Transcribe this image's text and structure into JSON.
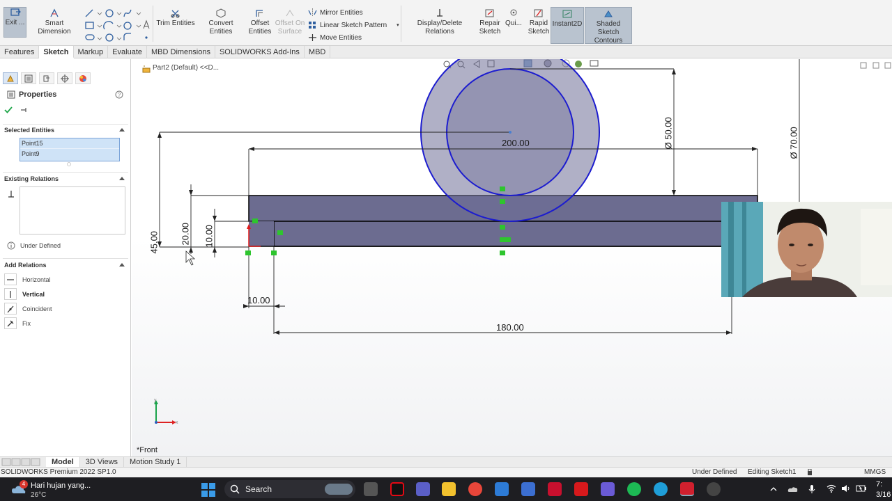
{
  "ribbon": {
    "exit_label": "Exit ...",
    "smart_dimension": "Smart Dimension",
    "trim_entities": "Trim Entities",
    "convert_entities": "Convert Entities",
    "offset_entities_line1": "Offset",
    "offset_entities_line2": "Entities",
    "offset_on_surface_line1": "Offset On",
    "offset_on_surface_line2": "Surface",
    "mirror_entities": "Mirror Entities",
    "linear_sketch_pattern": "Linear Sketch Pattern",
    "move_entities": "Move Entities",
    "display_delete_relations": "Display/Delete Relations",
    "repair_sketch_line1": "Repair",
    "repair_sketch_line2": "Sketch",
    "quick_snaps": "Qui...",
    "rapid_sketch_line1": "Rapid",
    "rapid_sketch_line2": "Sketch",
    "instant2d": "Instant2D",
    "shaded_sketch_line1": "Shaded Sketch",
    "shaded_sketch_line2": "Contours"
  },
  "command_tabs": [
    {
      "label": "Features"
    },
    {
      "label": "Sketch",
      "active": true
    },
    {
      "label": "Markup"
    },
    {
      "label": "Evaluate"
    },
    {
      "label": "MBD Dimensions"
    },
    {
      "label": "SOLIDWORKS Add-Ins"
    },
    {
      "label": "MBD"
    }
  ],
  "property_manager": {
    "title": "Properties",
    "selected_entities_header": "Selected Entities",
    "selected_entities": [
      "Point15",
      "Point9"
    ],
    "existing_relations_header": "Existing Relations",
    "status": "Under Defined",
    "add_relations_header": "Add Relations",
    "relations": [
      {
        "label": "Horizontal",
        "bold": false
      },
      {
        "label": "Vertical",
        "bold": true
      },
      {
        "label": "Coincident",
        "bold": false
      },
      {
        "label": "Fix",
        "bold": false
      }
    ]
  },
  "viewport": {
    "tree_label": "Part2 (Default) <<D...",
    "view_name": "*Front",
    "dimensions": {
      "d200": "200.00",
      "d180": "180.00",
      "d10h": "10.00",
      "d50": "Ø 50.00",
      "d70": "Ø 70.00",
      "d45": "45.00",
      "d20": "20.00",
      "d10v": "10.00"
    },
    "axis_x": "x",
    "axis_y": "y"
  },
  "model_tabs": [
    {
      "label": "Model",
      "active": true
    },
    {
      "label": "3D Views"
    },
    {
      "label": "Motion Study 1"
    }
  ],
  "statusbar": {
    "app": "SOLIDWORKS Premium 2022 SP1.0",
    "state": "Under Defined",
    "editing": "Editing Sketch1",
    "units": "MMGS"
  },
  "taskbar": {
    "weather_text": "Hari hujan yang...",
    "weather_temp": "26°C",
    "weather_badge": "4",
    "search": "Search",
    "clock_time": "7:",
    "clock_date": "3/16"
  },
  "colors": {
    "sketch_blue": "#1c1ccf",
    "fill_gray": "#6c6c90",
    "point_green": "#2ec52e",
    "origin_red": "#e01a1a"
  }
}
